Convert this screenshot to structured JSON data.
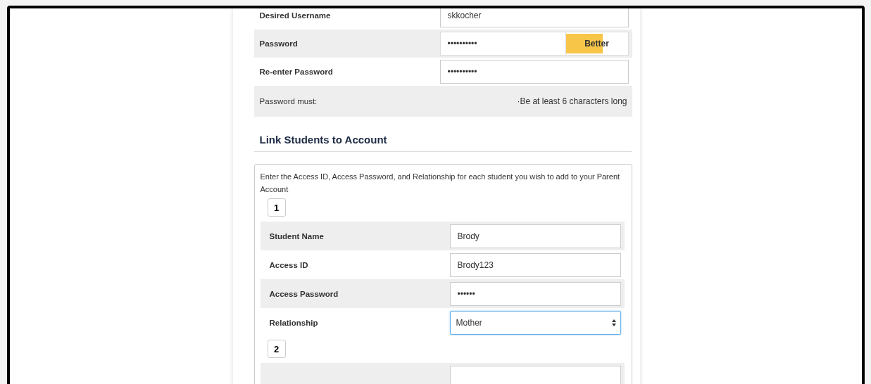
{
  "account_rows": [
    {
      "kind": "text",
      "label": "Desired Username",
      "value": "skkocher"
    },
    {
      "kind": "password_meter",
      "label": "Password",
      "value": "••••••••••",
      "strength": {
        "label": "Better",
        "level": 0.6
      }
    },
    {
      "kind": "password",
      "label": "Re-enter Password",
      "value": "••••••••••"
    },
    {
      "kind": "note",
      "label": "Password must:",
      "value": "·Be at least 6 characters long"
    }
  ],
  "section_title": "Link Students to Account",
  "instructions": "Enter the Access ID, Access Password, and Relationship for each student you wish to add to your Parent Account",
  "students": [
    {
      "number": "1",
      "rows": [
        {
          "kind": "text",
          "label": "Student Name",
          "value": "Brody"
        },
        {
          "kind": "text",
          "label": "Access ID",
          "value": "Brody123"
        },
        {
          "kind": "password",
          "label": "Access Password",
          "value": "••••••"
        },
        {
          "kind": "select",
          "label": "Relationship",
          "value": "Mother"
        }
      ]
    },
    {
      "number": "2",
      "rows": [
        {
          "kind": "text",
          "value": ""
        }
      ]
    }
  ]
}
